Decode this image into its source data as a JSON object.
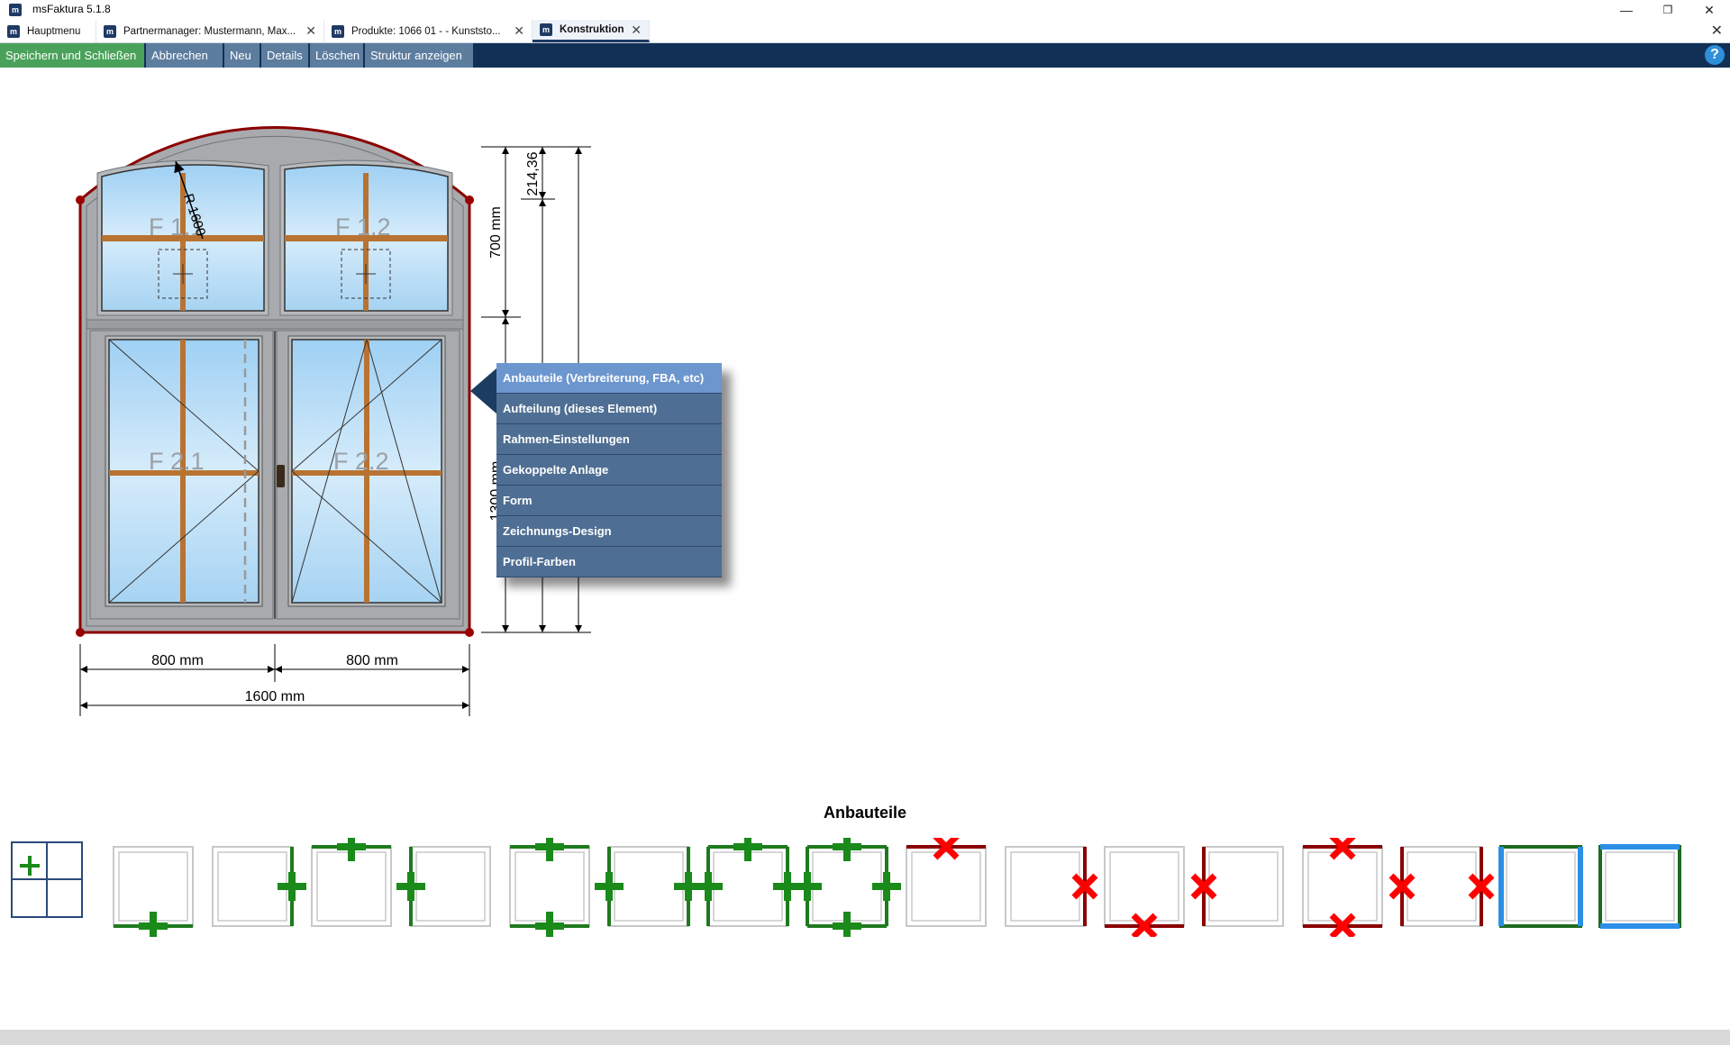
{
  "window": {
    "title": "msFaktura 5.1.8",
    "min": "—",
    "max": "❐",
    "close": "✕",
    "icon": "m"
  },
  "tabs": [
    {
      "label": "Hauptmenu",
      "closable": false,
      "active": false
    },
    {
      "label": "Partnermanager: Mustermann, Max...",
      "closable": true,
      "active": false
    },
    {
      "label": "Produkte: 1066 01 - - Kunststo...",
      "closable": true,
      "active": false
    },
    {
      "label": "Konstruktion",
      "closable": true,
      "active": true
    }
  ],
  "toolbar": {
    "save_close": "Speichern und Schließen",
    "cancel": "Abbrechen",
    "new": "Neu",
    "details": "Details",
    "delete": "Löschen",
    "structure": "Struktur anzeigen",
    "help": "?"
  },
  "drawing": {
    "fields": [
      "F 1.1",
      "F 1.2",
      "F 2.1",
      "F 2.2"
    ],
    "radius_label": "R 1600",
    "dim_width_left": "800 mm",
    "dim_width_right": "800 mm",
    "dim_width_total": "1600 mm",
    "dim_height_top": "700 mm",
    "dim_arc_rise": "214,36",
    "dim_height_bottom": "1300 mm"
  },
  "context_menu": {
    "items": [
      "Anbauteile (Verbreiterung, FBA, etc)",
      "Aufteilung (dieses Element)",
      "Rahmen-Einstellungen",
      "Gekoppelte Anlage",
      "Form",
      "Zeichnungs-Design",
      "Profil-Farben"
    ],
    "active_index": 0
  },
  "anbauteile": {
    "title": "Anbauteile",
    "tiles": [
      {
        "name": "add-bottom",
        "kind": "add",
        "sides": [
          "bottom"
        ]
      },
      {
        "name": "add-right",
        "kind": "add",
        "sides": [
          "right"
        ]
      },
      {
        "name": "add-top",
        "kind": "add",
        "sides": [
          "top"
        ]
      },
      {
        "name": "add-left",
        "kind": "add",
        "sides": [
          "left"
        ]
      },
      {
        "name": "add-top-bottom",
        "kind": "add",
        "sides": [
          "top",
          "bottom"
        ]
      },
      {
        "name": "add-left-right",
        "kind": "add",
        "sides": [
          "left",
          "right"
        ]
      },
      {
        "name": "add-top-left-right",
        "kind": "add",
        "sides": [
          "top",
          "left",
          "right"
        ]
      },
      {
        "name": "add-all",
        "kind": "add",
        "sides": [
          "top",
          "bottom",
          "left",
          "right"
        ]
      },
      {
        "name": "remove-top",
        "kind": "remove",
        "sides": [
          "top"
        ]
      },
      {
        "name": "remove-right",
        "kind": "remove",
        "sides": [
          "right"
        ]
      },
      {
        "name": "remove-bottom",
        "kind": "remove",
        "sides": [
          "bottom"
        ]
      },
      {
        "name": "remove-left",
        "kind": "remove",
        "sides": [
          "left"
        ]
      },
      {
        "name": "remove-top-bottom",
        "kind": "remove",
        "sides": [
          "top",
          "bottom"
        ]
      },
      {
        "name": "remove-left-right",
        "kind": "remove",
        "sides": [
          "left",
          "right"
        ]
      },
      {
        "name": "blue-left-right",
        "kind": "blue",
        "sides": [
          "left",
          "right"
        ]
      },
      {
        "name": "blue-top-bottom",
        "kind": "blue",
        "sides": [
          "top",
          "bottom"
        ]
      }
    ]
  },
  "colors": {
    "toolbar_bg": "#123055",
    "primary": "#4aa25a",
    "menu_bg": "#4f6e93",
    "menu_active": "#6c96ce",
    "add": "#1a8a1a",
    "remove": "#ff0000",
    "frame_red": "#8b0000",
    "blue": "#2b8fe6"
  }
}
